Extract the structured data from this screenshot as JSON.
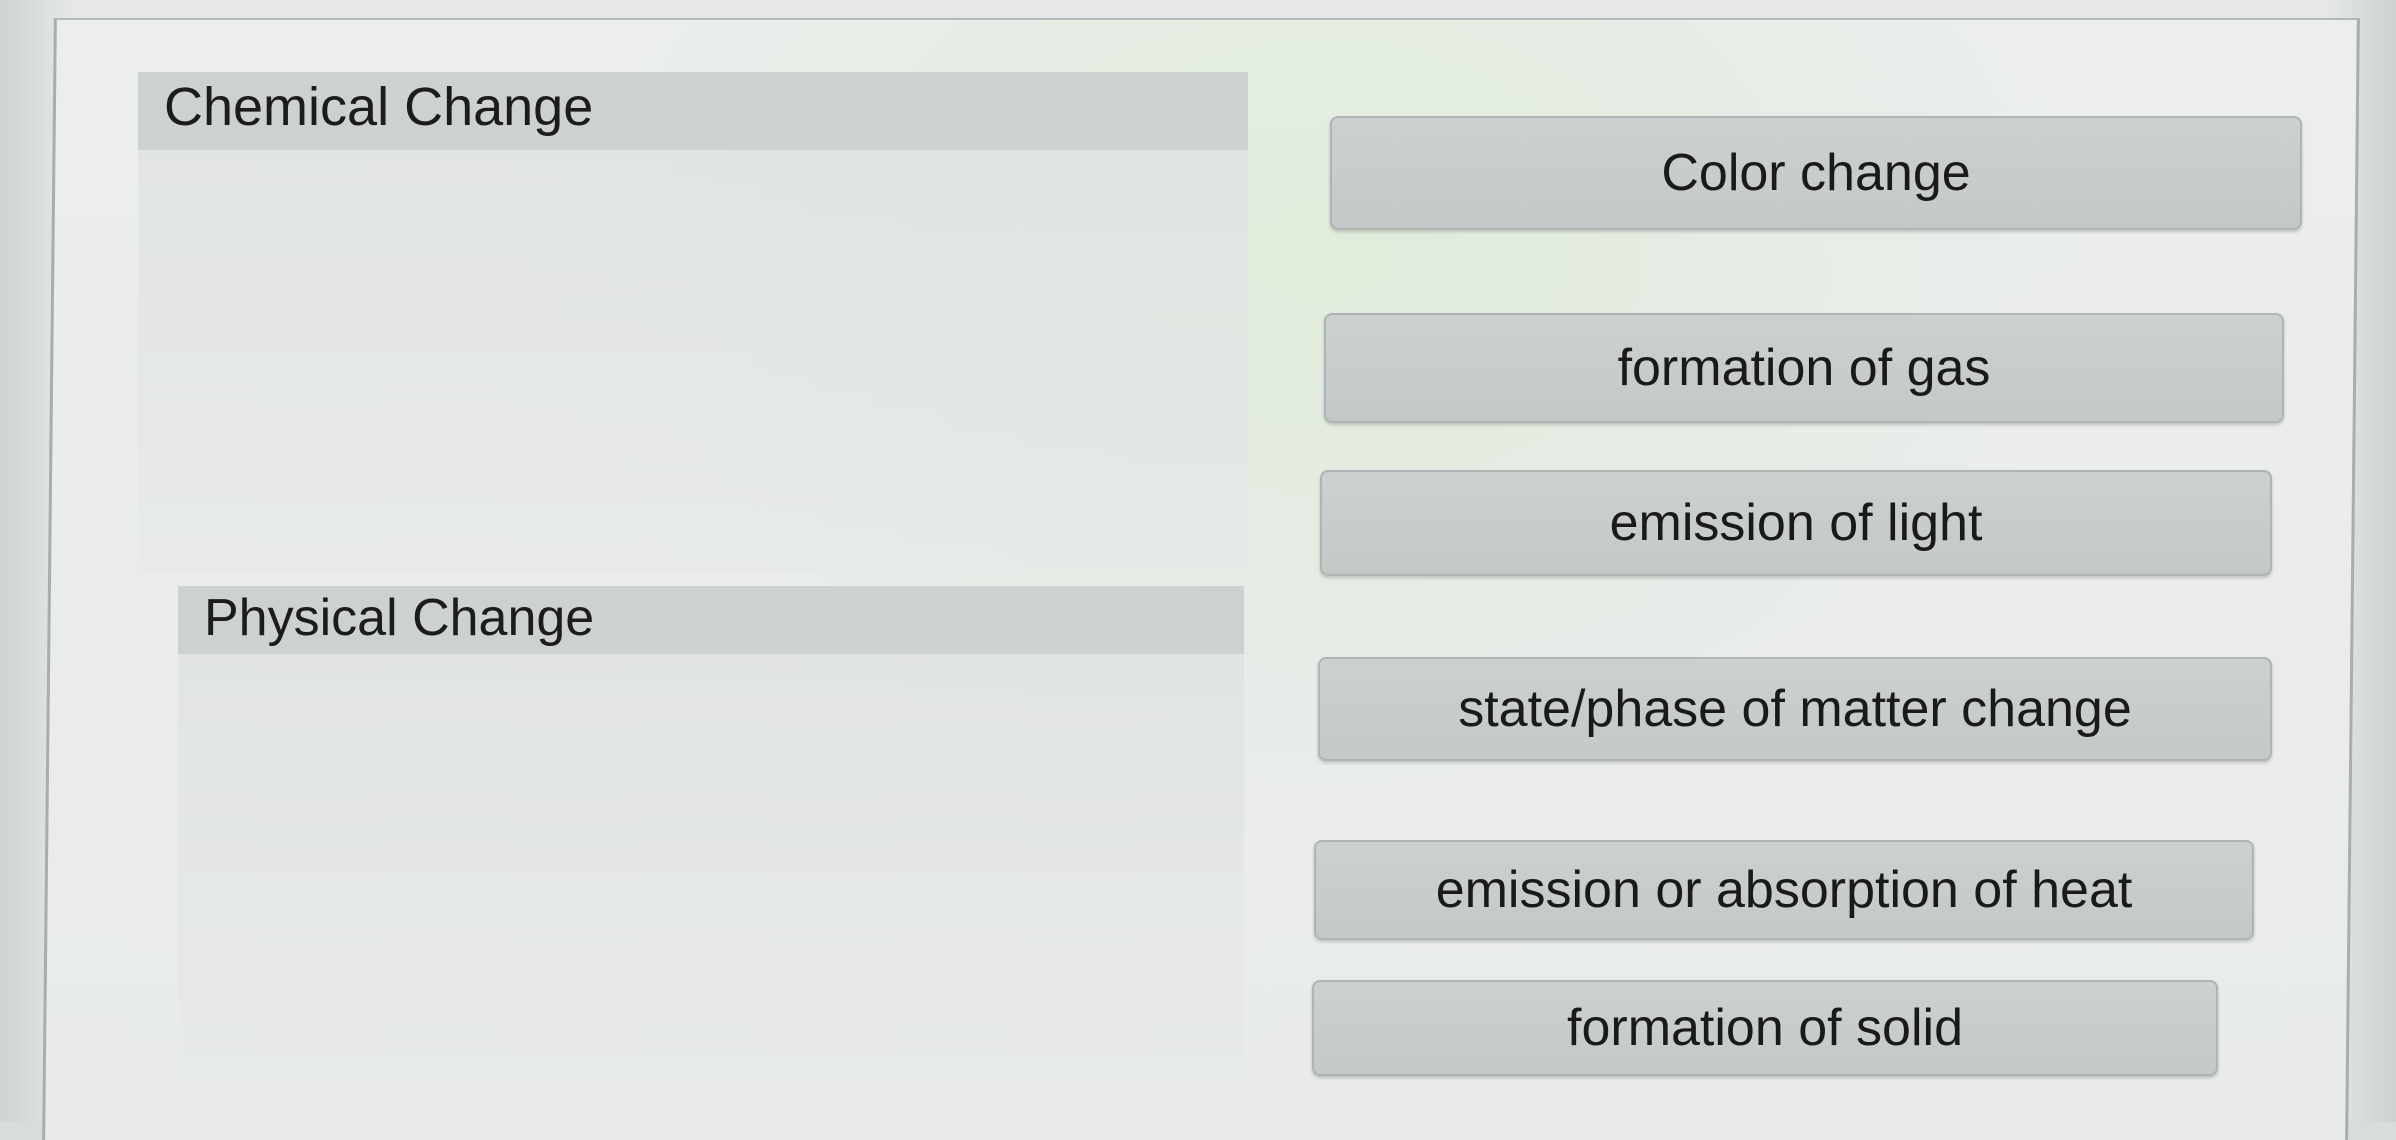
{
  "categories": [
    {
      "label": "Chemical Change"
    },
    {
      "label": "Physical Change"
    }
  ],
  "items": [
    {
      "label": "Color change"
    },
    {
      "label": "formation of gas"
    },
    {
      "label": "emission of light"
    },
    {
      "label": "state/phase of matter change"
    },
    {
      "label": "emission or absorption of heat"
    },
    {
      "label": "formation of solid"
    }
  ]
}
